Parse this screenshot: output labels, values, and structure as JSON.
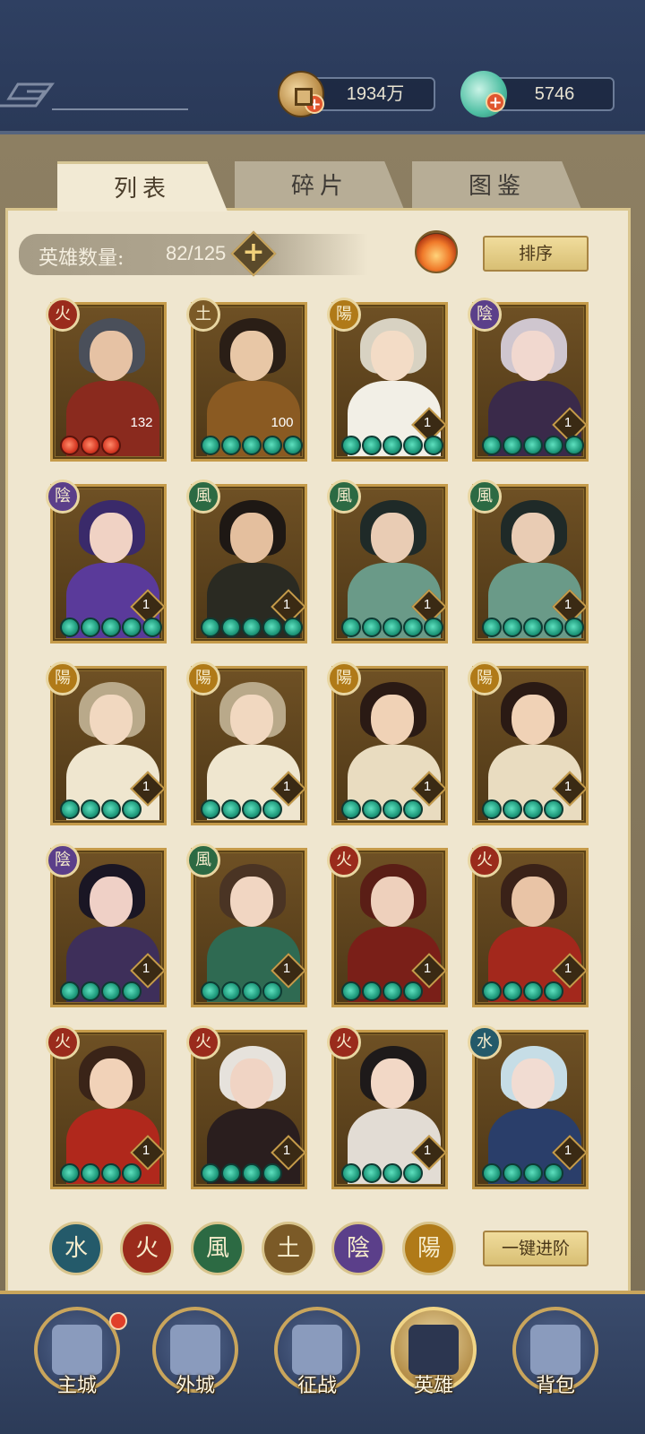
{
  "currencies": {
    "coins": {
      "amount": "1934万",
      "icon": "coin-icon"
    },
    "jade": {
      "amount": "5746",
      "icon": "jade-icon"
    }
  },
  "tabs": [
    {
      "label": "列表",
      "active": true
    },
    {
      "label": "碎片",
      "active": false
    },
    {
      "label": "图鉴",
      "active": false
    }
  ],
  "hero_count": {
    "label": "英雄数量:",
    "value": "82/125"
  },
  "sort_label": "排序",
  "upgrade_all_label": "一键进阶",
  "heroes": [
    {
      "element": "火",
      "el_class": "el-fire",
      "level": "132",
      "stars": 3,
      "star_color": "red",
      "hair": "#4a4f5a",
      "body": "#8a2a1e",
      "skin": "#e6c2a4"
    },
    {
      "element": "土",
      "el_class": "el-earth",
      "level": "100",
      "stars": 5,
      "star_color": "green",
      "hair": "#2a1e16",
      "body": "#8a5a22",
      "skin": "#e8c7a6"
    },
    {
      "element": "陽",
      "el_class": "el-yang",
      "level": "1",
      "stars": 5,
      "star_color": "green",
      "hair": "#d8d2c2",
      "body": "#f2efe6",
      "skin": "#f3dcc6"
    },
    {
      "element": "陰",
      "el_class": "el-yin",
      "level": "1",
      "stars": 5,
      "star_color": "green",
      "hair": "#cfc6cf",
      "body": "#3a2a4a",
      "skin": "#f1d8cf"
    },
    {
      "element": "陰",
      "el_class": "el-yin",
      "level": "1",
      "stars": 5,
      "star_color": "green",
      "hair": "#3a2a6a",
      "body": "#5a3a9a",
      "skin": "#f0d2c4"
    },
    {
      "element": "風",
      "el_class": "el-wind",
      "level": "1",
      "stars": 5,
      "star_color": "green",
      "hair": "#1e1814",
      "body": "#2a2a22",
      "skin": "#e4bf9e"
    },
    {
      "element": "風",
      "el_class": "el-wind",
      "level": "1",
      "stars": 5,
      "star_color": "green",
      "hair": "#1f2a28",
      "body": "#6a9a88",
      "skin": "#e9ccb4"
    },
    {
      "element": "風",
      "el_class": "el-wind",
      "level": "1",
      "stars": 5,
      "star_color": "green",
      "hair": "#1f2a28",
      "body": "#6a9a88",
      "skin": "#e9ccb4"
    },
    {
      "element": "陽",
      "el_class": "el-yang",
      "level": "1",
      "stars": 4,
      "star_color": "green",
      "hair": "#b9a98a",
      "body": "#efe6cf",
      "skin": "#f1d8c0"
    },
    {
      "element": "陽",
      "el_class": "el-yang",
      "level": "1",
      "stars": 4,
      "star_color": "green",
      "hair": "#b9a98a",
      "body": "#efe6cf",
      "skin": "#f1d8c0"
    },
    {
      "element": "陽",
      "el_class": "el-yang",
      "level": "1",
      "stars": 4,
      "star_color": "green",
      "hair": "#2a1a14",
      "body": "#e9dcc0",
      "skin": "#f0d2b6"
    },
    {
      "element": "陽",
      "el_class": "el-yang",
      "level": "1",
      "stars": 4,
      "star_color": "green",
      "hair": "#2a1a14",
      "body": "#e9dcc0",
      "skin": "#f0d2b6"
    },
    {
      "element": "陰",
      "el_class": "el-yin",
      "level": "1",
      "stars": 4,
      "star_color": "green",
      "hair": "#1a1624",
      "body": "#3e2f5a",
      "skin": "#efd0c6"
    },
    {
      "element": "風",
      "el_class": "el-wind",
      "level": "1",
      "stars": 4,
      "star_color": "green",
      "hair": "#4a3424",
      "body": "#2f6a52",
      "skin": "#f1d6c2"
    },
    {
      "element": "火",
      "el_class": "el-fire",
      "level": "1",
      "stars": 4,
      "star_color": "green",
      "hair": "#5a1e16",
      "body": "#7a1f18",
      "skin": "#eed0bc"
    },
    {
      "element": "火",
      "el_class": "el-fire",
      "level": "1",
      "stars": 4,
      "star_color": "green",
      "hair": "#3a2218",
      "body": "#a3281c",
      "skin": "#e9c4a6"
    },
    {
      "element": "火",
      "el_class": "el-fire",
      "level": "1",
      "stars": 4,
      "star_color": "green",
      "hair": "#3a2418",
      "body": "#b0281c",
      "skin": "#f1d2b8"
    },
    {
      "element": "火",
      "el_class": "el-fire",
      "level": "1",
      "stars": 4,
      "star_color": "green",
      "hair": "#e6e2dc",
      "body": "#2a1e1e",
      "skin": "#f0d4c4"
    },
    {
      "element": "火",
      "el_class": "el-fire",
      "level": "1",
      "stars": 4,
      "star_color": "green",
      "hair": "#1e1a1a",
      "body": "#e2dcd4",
      "skin": "#f2d8c6"
    },
    {
      "element": "水",
      "el_class": "el-water",
      "level": "1",
      "stars": 4,
      "star_color": "green",
      "hair": "#c6dde6",
      "body": "#2a3e6a",
      "skin": "#f1dcd2"
    }
  ],
  "element_filters": [
    {
      "glyph": "水",
      "el_class": "el-water"
    },
    {
      "glyph": "火",
      "el_class": "el-fire"
    },
    {
      "glyph": "風",
      "el_class": "el-wind"
    },
    {
      "glyph": "土",
      "el_class": "el-earth"
    },
    {
      "glyph": "陰",
      "el_class": "el-yin"
    },
    {
      "glyph": "陽",
      "el_class": "el-yang"
    }
  ],
  "nav": [
    {
      "label": "主城",
      "icon": "main-city-icon",
      "active": false,
      "notification": true
    },
    {
      "label": "外城",
      "icon": "outer-city-icon",
      "active": false,
      "notification": false
    },
    {
      "label": "征战",
      "icon": "campaign-icon",
      "active": false,
      "notification": false
    },
    {
      "label": "英雄",
      "icon": "hero-icon",
      "active": true,
      "notification": false
    },
    {
      "label": "背包",
      "icon": "backpack-icon",
      "active": false,
      "notification": false
    }
  ]
}
